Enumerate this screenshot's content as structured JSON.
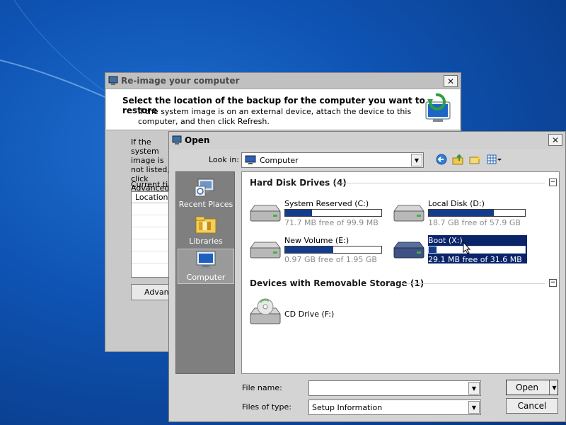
{
  "reimage_dialog": {
    "title": "Re-image your computer",
    "heading": "Select the location of the backup for the computer you want to restore",
    "subtext": "If the system image is on an external device, attach the device to this computer, and then click Refresh.",
    "body_text": "If the system image is not listed, click Advanced to look for it, or click up in the list",
    "current_time_label": "Current time",
    "table_header": "Location",
    "advanced_button": "Advanced..."
  },
  "open_dialog": {
    "title": "Open",
    "look_in_label": "Look in:",
    "look_in_value": "Computer",
    "places": [
      {
        "label": "Recent Places",
        "icon": "recent-places-icon"
      },
      {
        "label": "Libraries",
        "icon": "libraries-icon"
      },
      {
        "label": "Computer",
        "icon": "computer-icon"
      }
    ],
    "groups": [
      {
        "title": "Hard Disk Drives (4)"
      },
      {
        "title": "Devices with Removable Storage (1)"
      }
    ],
    "drives": [
      {
        "name": "System Reserved (C:)",
        "free": "71.7 MB free of 99.9 MB",
        "used_fraction": 0.28
      },
      {
        "name": "Local Disk (D:)",
        "free": "18.7 GB free of 57.9 GB",
        "used_fraction": 0.68
      },
      {
        "name": "New Volume (E:)",
        "free": "0.97 GB free of 1.95 GB",
        "used_fraction": 0.5
      },
      {
        "name": "Boot (X:)",
        "free": "29.1 MB free of 31.6 MB",
        "used_fraction": 0.08
      }
    ],
    "removable": [
      {
        "name": "CD Drive (F:)"
      }
    ],
    "file_name_label": "File name:",
    "file_name_value": "",
    "files_of_type_label": "Files of type:",
    "files_of_type_value": "Setup Information",
    "open_button": "Open",
    "cancel_button": "Cancel"
  },
  "colors": {
    "desktop": "#0f54b4",
    "selection": "#0a246a",
    "bar_fill": "#143c8c"
  }
}
